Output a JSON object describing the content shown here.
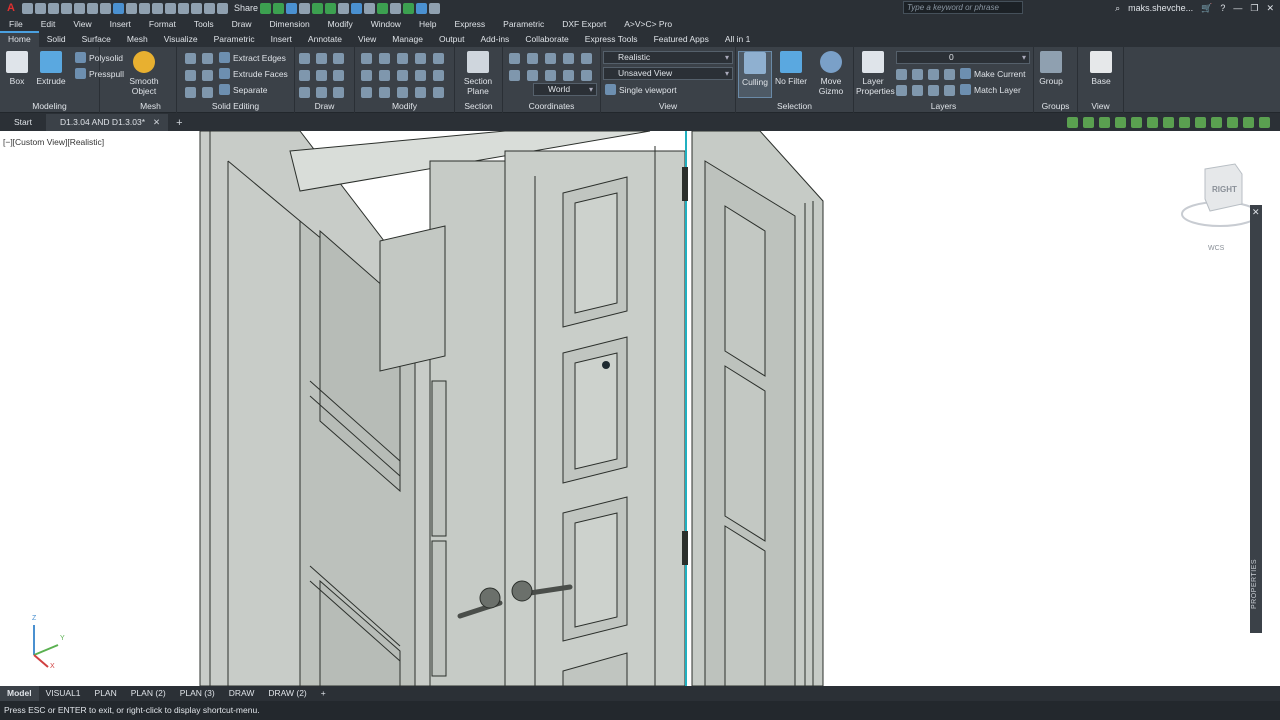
{
  "app": {
    "logo": "A",
    "share_label": "Share",
    "search_placeholder": "Type a keyword or phrase",
    "user": "maks.shevche..."
  },
  "menu": [
    "File",
    "Edit",
    "View",
    "Insert",
    "Format",
    "Tools",
    "Draw",
    "Dimension",
    "Modify",
    "Window",
    "Help",
    "Express",
    "Parametric",
    "DXF Export",
    "A>V>C> Pro"
  ],
  "ribbon_tabs": [
    "Home",
    "Solid",
    "Surface",
    "Mesh",
    "Visualize",
    "Parametric",
    "Insert",
    "Annotate",
    "View",
    "Manage",
    "Output",
    "Add-ins",
    "Collaborate",
    "Express Tools",
    "Featured Apps",
    "All in 1"
  ],
  "ribbon": {
    "modeling": {
      "title": "Modeling",
      "box": "Box",
      "extrude": "Extrude",
      "polysolid": "Polysolid",
      "presspull": "Presspull"
    },
    "mesh": {
      "title": "Mesh",
      "smooth_object_1": "Smooth",
      "smooth_object_2": "Object"
    },
    "solid_editing": {
      "title": "Solid Editing",
      "extract_edges": "Extract Edges",
      "extrude_faces": "Extrude Faces",
      "separate": "Separate"
    },
    "draw": {
      "title": "Draw"
    },
    "modify": {
      "title": "Modify"
    },
    "section": {
      "title": "Section",
      "section_plane_1": "Section",
      "section_plane_2": "Plane"
    },
    "coordinates": {
      "title": "Coordinates",
      "ucs": "World"
    },
    "view": {
      "title": "View",
      "visual_style": "Realistic",
      "named_view": "Unsaved View",
      "viewport": "Single viewport"
    },
    "selection": {
      "title": "Selection",
      "culling": "Culling",
      "no_filter": "No Filter",
      "move_gizmo_1": "Move",
      "move_gizmo_2": "Gizmo"
    },
    "layers": {
      "title": "Layers",
      "layer_properties_1": "Layer",
      "layer_properties_2": "Properties",
      "layer_value": "0",
      "make_current": "Make Current",
      "match_layer": "Match Layer"
    },
    "groups": {
      "title": "Groups",
      "group": "Group"
    },
    "view2": {
      "title": "View",
      "base": "Base"
    }
  },
  "doc_tabs": [
    {
      "label": "Start",
      "active": false
    },
    {
      "label": "D1.3.04 AND D1.3.03*",
      "active": true
    }
  ],
  "viewport": {
    "label": "[−][Custom View][Realistic]",
    "viewcube_face": "RIGHT",
    "wcs": "WCS",
    "properties_label": "PROPERTIES",
    "ucs_x": "X",
    "ucs_y": "Y",
    "ucs_z": "Z"
  },
  "layout_tabs": [
    "Model",
    "VISUAL1",
    "PLAN",
    "PLAN (2)",
    "PLAN (3)",
    "DRAW",
    "DRAW (2)"
  ],
  "command_line": "Press ESC or ENTER to exit, or right-click to display shortcut-menu.",
  "colors": {
    "ribbon_bg": "#3b4148",
    "chrome_bg": "#2b3036",
    "accent": "#4aa0e0",
    "door_fill": "#c9cdc9",
    "door_edge": "#2b2f2b"
  }
}
